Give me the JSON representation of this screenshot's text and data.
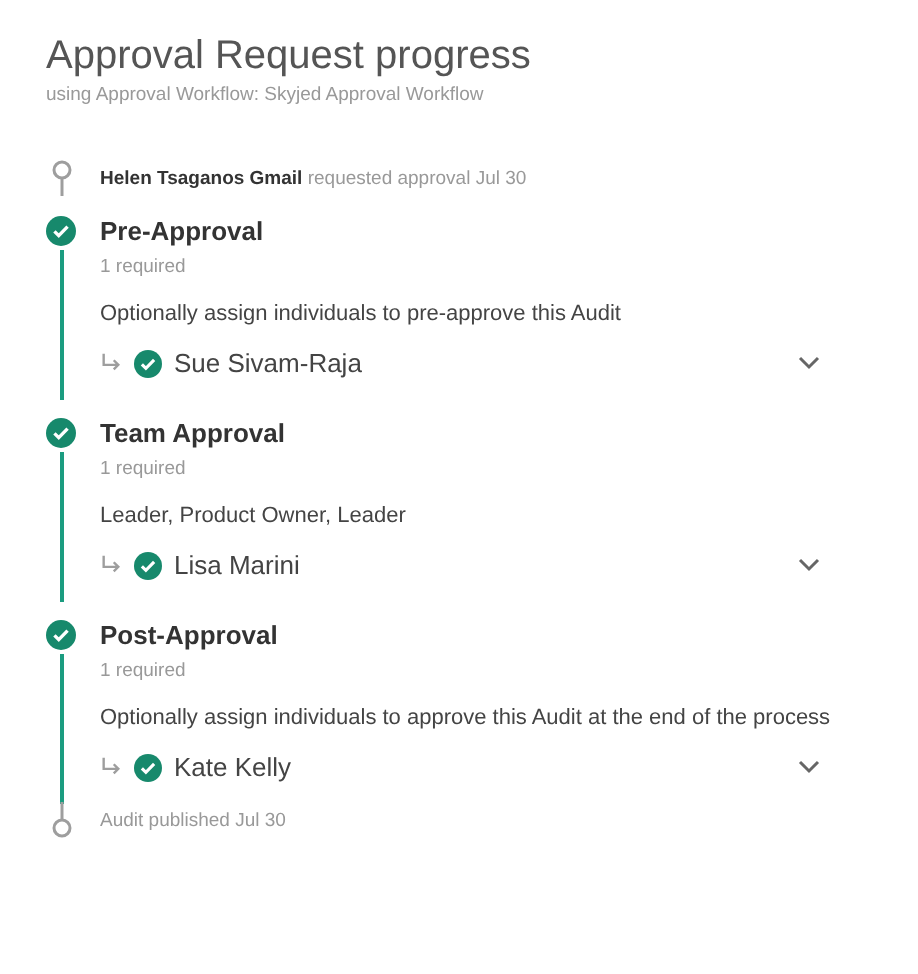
{
  "title": "Approval Request progress",
  "subtitle": "using Approval Workflow: Skyjed Approval Workflow",
  "start": {
    "text": "**Helen Tsaganos Gmail** requested approval Jul 30"
  },
  "steps": [
    {
      "title": "Pre-Approval",
      "required": "1 required",
      "description": "Optionally assign individuals to pre-approve this Audit",
      "completed": true,
      "assignees": [
        {
          "name": "Sue Sivam-Raja",
          "approved": true
        }
      ]
    },
    {
      "title": "Team Approval",
      "required": "1 required",
      "description": "Leader, Product Owner, Leader",
      "completed": true,
      "assignees": [
        {
          "name": "Lisa Marini",
          "approved": true
        }
      ]
    },
    {
      "title": "Post-Approval",
      "required": "1 required",
      "description": "Optionally assign individuals to approve this Audit at the end of the process",
      "completed": true,
      "assignees": [
        {
          "name": "Kate Kelly",
          "approved": true
        }
      ]
    }
  ],
  "end": {
    "text": "Audit published Jul 30"
  }
}
